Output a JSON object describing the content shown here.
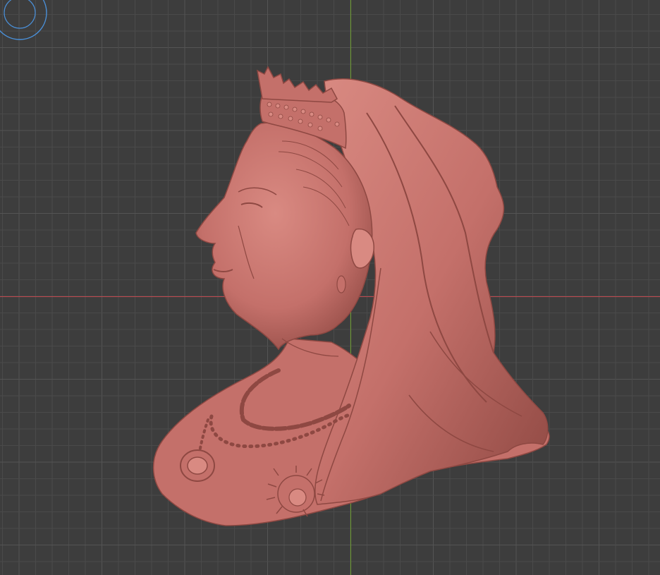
{
  "viewport": {
    "background_color": "#3d3d3d",
    "grid_minor_color": "#4a4a4a",
    "grid_major_color": "#545454",
    "x_axis_color": "#c0474e",
    "y_axis_color": "#6c9a2f",
    "gizmo_color": "#4a90d9"
  },
  "model": {
    "material_color": "#c4706a",
    "shade_dark": "#8e4842",
    "shade_light": "#d98a82",
    "icon": "relief-portrait-mesh"
  }
}
